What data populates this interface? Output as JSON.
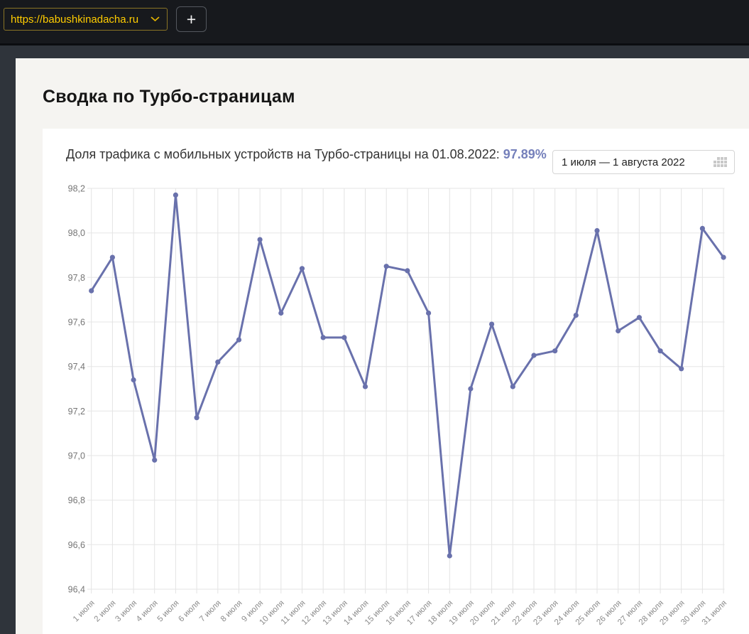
{
  "browser": {
    "url": "https://babushkinadacha.ru",
    "add_tab_label": "+"
  },
  "page": {
    "title": "Сводка по Турбо-страницам"
  },
  "card": {
    "title_prefix": "Доля трафика с мобильных устройств на Турбо-страницы на 01.08.2022:",
    "value": "97.89%",
    "date_range": "1 июля — 1 августа 2022"
  },
  "colors": {
    "accent_yellow": "#ffcc00",
    "line": "#6971ac",
    "value_accent": "#7580bb",
    "grid": "#e5e5e5",
    "y_label": "#757575",
    "x_label": "#8c8c8c"
  },
  "chart_data": {
    "type": "line",
    "title": "Доля трафика с мобильных устройств на Турбо-страницы на 01.08.2022: 97.89%",
    "categories": [
      "1 июля",
      "2 июля",
      "3 июля",
      "4 июля",
      "5 июля",
      "6 июля",
      "7 июля",
      "8 июля",
      "9 июля",
      "10 июля",
      "11 июля",
      "12 июля",
      "13 июля",
      "14 июля",
      "15 июля",
      "16 июля",
      "17 июля",
      "18 июля",
      "19 июля",
      "20 июля",
      "21 июля",
      "22 июля",
      "23 июля",
      "24 июля",
      "25 июля",
      "26 июля",
      "27 июля",
      "28 июля",
      "29 июля",
      "30 июля",
      "31 июля"
    ],
    "values": [
      97.74,
      97.89,
      97.34,
      96.98,
      98.17,
      97.17,
      97.42,
      97.52,
      97.97,
      97.64,
      97.84,
      97.53,
      97.53,
      97.31,
      97.85,
      97.83,
      97.64,
      96.55,
      97.3,
      97.59,
      97.31,
      97.45,
      97.47,
      97.63,
      98.01,
      97.56,
      97.62,
      97.47,
      97.39,
      98.02,
      97.89
    ],
    "xlabel": "",
    "ylabel": "",
    "ylim": [
      96.4,
      98.2
    ],
    "ytick_step": 0.2,
    "ytick_labels": [
      "98,2",
      "98,0",
      "97,8",
      "97,6",
      "97,4",
      "97,2",
      "97,0",
      "96,8",
      "96,6",
      "96,4"
    ],
    "grid": true,
    "legend": false
  }
}
